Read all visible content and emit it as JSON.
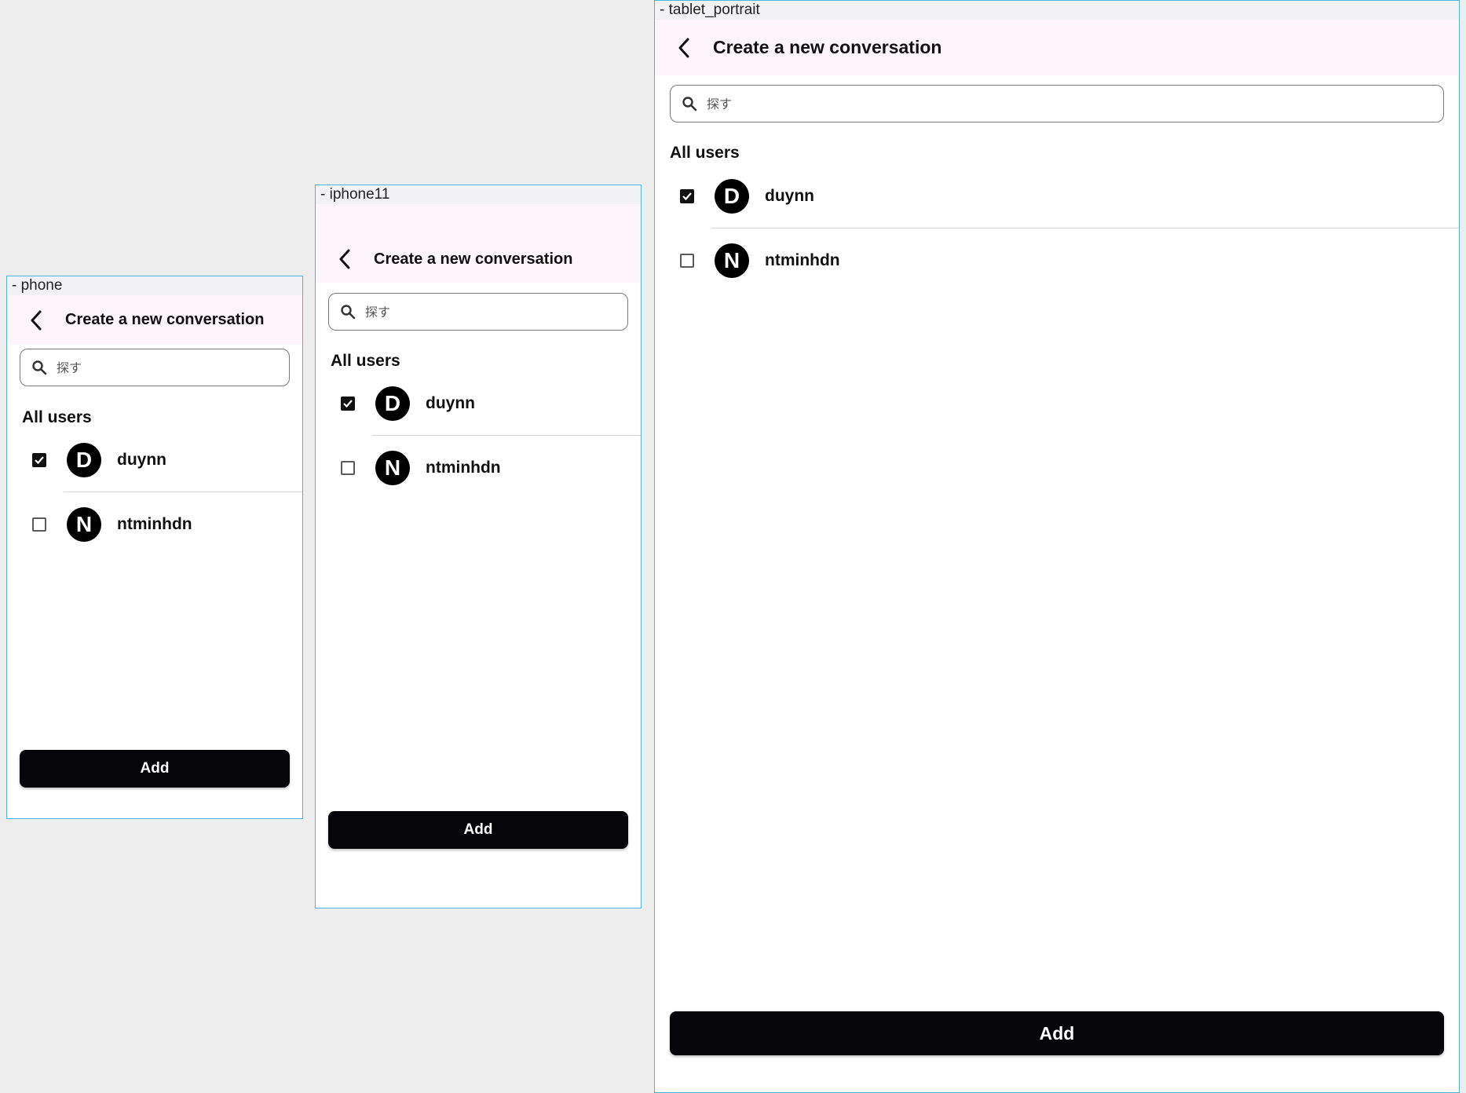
{
  "frames": {
    "phone": {
      "label": "- phone",
      "title": "Create a new conversation",
      "search_placeholder": "探す",
      "section_title": "All users",
      "users": [
        {
          "initial": "D",
          "name": "duynn",
          "checked": true
        },
        {
          "initial": "N",
          "name": "ntminhdn",
          "checked": false
        }
      ],
      "add_label": "Add"
    },
    "iphone11": {
      "label": "- iphone11",
      "title": "Create a new conversation",
      "search_placeholder": "探す",
      "section_title": "All users",
      "users": [
        {
          "initial": "D",
          "name": "duynn",
          "checked": true
        },
        {
          "initial": "N",
          "name": "ntminhdn",
          "checked": false
        }
      ],
      "add_label": "Add"
    },
    "tablet": {
      "label": "- tablet_portrait",
      "title": "Create a new conversation",
      "search_placeholder": "探す",
      "section_title": "All users",
      "users": [
        {
          "initial": "D",
          "name": "duynn",
          "checked": true
        },
        {
          "initial": "N",
          "name": "ntminhdn",
          "checked": false
        }
      ],
      "add_label": "Add"
    }
  },
  "icons": {
    "back": "chevron-left-icon",
    "search": "magnifier-icon",
    "check": "checkmark-icon"
  },
  "colors": {
    "appbar_bg": "#fdf5fa",
    "button_bg": "#050509",
    "frame_border": "#4fb3e0",
    "canvas_bg": "#ededed"
  }
}
